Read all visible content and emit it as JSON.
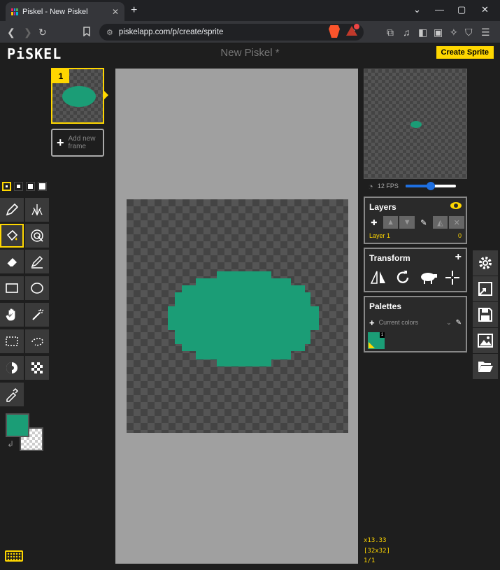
{
  "browser": {
    "tab_title": "Piskel - New Piskel",
    "tab_close": "✕",
    "new_tab": "+",
    "url": "piskelapp.com/p/create/sprite",
    "window_controls": [
      "⌄",
      "—",
      "▢",
      "✕"
    ]
  },
  "app": {
    "logo": "PiSKEL",
    "document_title": "New Piskel *",
    "create_sprite_label": "Create Sprite"
  },
  "frames": {
    "items": [
      {
        "number": "1"
      }
    ],
    "add_frame_label": "Add new frame"
  },
  "colors": {
    "primary": "#1b9d76",
    "accent": "#ffd700",
    "canvas_bg": "#a0a0a0"
  },
  "tools": [
    {
      "name": "pen",
      "active": false
    },
    {
      "name": "vertical-mirror-pen",
      "active": false
    },
    {
      "name": "paint-bucket",
      "active": true
    },
    {
      "name": "paint-all-same-color",
      "active": false
    },
    {
      "name": "eraser",
      "active": false
    },
    {
      "name": "stroke",
      "active": false
    },
    {
      "name": "rectangle",
      "active": false
    },
    {
      "name": "circle",
      "active": false
    },
    {
      "name": "move",
      "active": false
    },
    {
      "name": "shape-selection",
      "active": false
    },
    {
      "name": "rectangle-selection",
      "active": false
    },
    {
      "name": "lasso-selection",
      "active": false
    },
    {
      "name": "lighten",
      "active": false
    },
    {
      "name": "dithering",
      "active": false
    },
    {
      "name": "color-picker",
      "active": false
    }
  ],
  "preview": {
    "fps_label": "12 FPS",
    "fps_value": 12,
    "fps_max": 24
  },
  "layers": {
    "title": "Layers",
    "items": [
      {
        "name": "Layer 1",
        "opacity": "0"
      }
    ]
  },
  "transform": {
    "title": "Transform",
    "plus": "+"
  },
  "palettes": {
    "title": "Palettes",
    "plus": "+",
    "selected": "Current colors",
    "caret": "⌄",
    "swatch_count": "1"
  },
  "status": {
    "zoom": "x13.33",
    "size": "[32x32]",
    "frame": "1/1"
  }
}
